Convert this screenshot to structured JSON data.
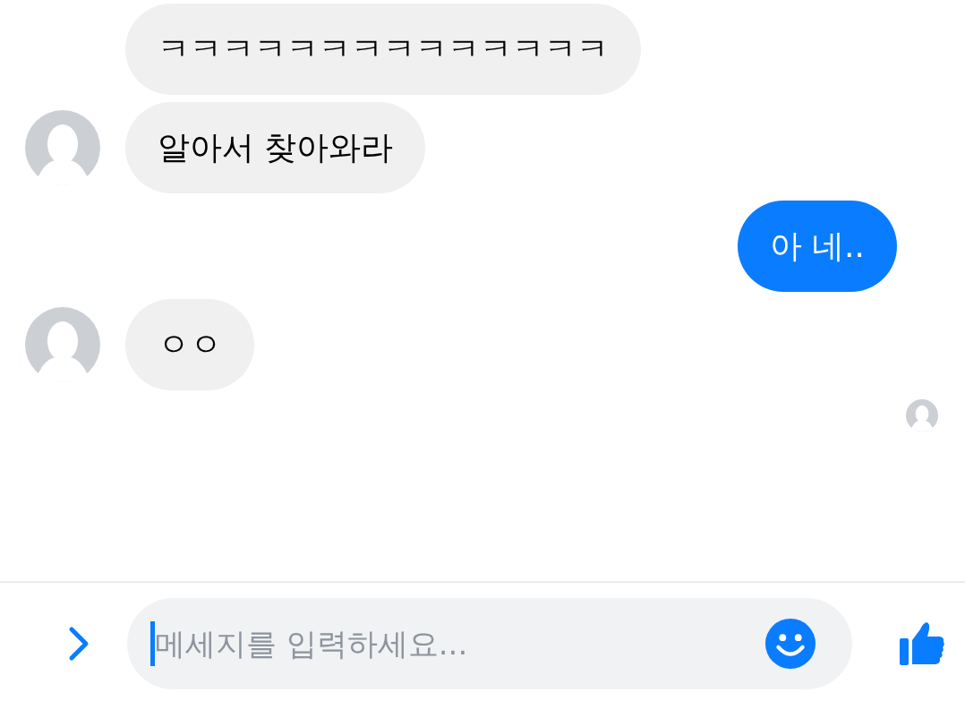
{
  "messages": [
    {
      "kind": "incoming",
      "avatar": false,
      "text": "ㅋㅋㅋㅋㅋㅋㅋㅋㅋㅋㅋㅋㅋㅋ"
    },
    {
      "kind": "incoming",
      "avatar": true,
      "text": "알아서 찾아와라"
    },
    {
      "kind": "outgoing",
      "text": "아 네.."
    },
    {
      "kind": "incoming",
      "avatar": true,
      "text": "ㅇㅇ"
    }
  ],
  "read_receipt": {
    "seen": true
  },
  "composer": {
    "placeholder": "메세지를 입력하세요..."
  }
}
